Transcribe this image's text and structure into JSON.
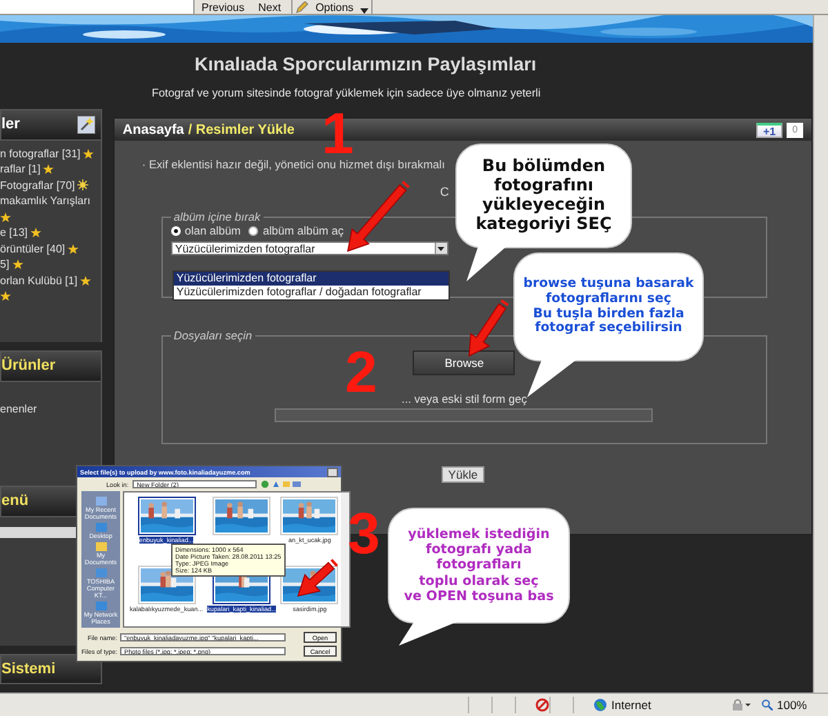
{
  "browser_toolbar": {
    "buttons": [
      "Previous",
      "Next"
    ],
    "options": "Options"
  },
  "header": {
    "title": "Kınalıada Sporcularımızın Paylaşımları",
    "subtitle": "Fotograf ve yorum sitesinde fotograf yüklemek için sadece üye olmanız yeterli"
  },
  "sidebar": {
    "panels": [
      {
        "title": "ler",
        "color": "#ffffff",
        "kind": "list",
        "items": [
          {
            "label": "n fotograflar [31]",
            "kind": "new"
          },
          {
            "label": "raflar [1]",
            "kind": "new"
          },
          {
            "label": "Fotograflar [70]",
            "kind": "hot"
          },
          {
            "label": "makamlık Yarışları",
            "kind": "plain"
          },
          {
            "kind": "new"
          },
          {
            "label": "e [13]",
            "kind": "new"
          },
          {
            "label": "örüntüler [40]",
            "kind": "new"
          },
          {
            "label": "5]",
            "kind": "new"
          },
          {
            "label": "orlan Kulübü [1]",
            "kind": "new"
          },
          {
            "kind": "new"
          }
        ]
      },
      {
        "title": "Ürünler",
        "color": "#f0e060",
        "kind": "links",
        "items": [
          {
            "label": "enenler"
          }
        ]
      },
      {
        "title": "enü",
        "color": "#f0e060",
        "kind": "menu"
      },
      {
        "title": "Sistemi",
        "color": "#f0e060",
        "kind": "header"
      }
    ]
  },
  "main": {
    "home": "Anasayfa",
    "current": "/ Resimler Yükle",
    "plus_one": {
      "label": "+1",
      "count": "0"
    },
    "notice": "· Exif eklentisi hazır değil, yönetici onu hizmet dışı bırakmalı",
    "partial_text": "C",
    "album": {
      "legend": "albüm içine bırak",
      "radios": [
        {
          "label": "olan albüm",
          "selected": true
        },
        {
          "label": "albüm albüm aç",
          "selected": false
        }
      ],
      "select_value": "Yüzücülerimizden fotograflar",
      "options": [
        {
          "label": "Yüzücülerimizden fotograflar",
          "selected": true
        },
        {
          "label": "Yüzücülerimizden fotograflar / doğadan fotograflar",
          "selected": false
        }
      ]
    },
    "files": {
      "legend": "Dosyaları seçin",
      "browse": "Browse",
      "alt_link": "... veya eski stil form geç"
    },
    "upload": "Yükle"
  },
  "callouts": [
    {
      "number": "1",
      "text": "Bu bölümden\nfotografını\nyükleyeceğin\nkategoriyi SEÇ",
      "color": "#111111"
    },
    {
      "number": "2",
      "text": "browse tuşuna basarak\nfotograflarını seç\nBu tuşla birden fazla\nfotograf seçebilirsin",
      "color": "#1a4fd6"
    },
    {
      "number": "3",
      "text": "yüklemek istediğin\nfotografı  yada\nfotografları\ntoplu olarak seç\nve OPEN toşuna bas",
      "color": "#b02cc0"
    }
  ],
  "dialog": {
    "title": "Select file(s) to upload by www.foto.kinaliadayuzme.com",
    "look_in_label": "Look in:",
    "folder": "New Folder (2)",
    "places": [
      "My Recent Documents",
      "Desktop",
      "My Documents",
      "TOSHIBA Computer KT...",
      "My Network Places"
    ],
    "files": [
      {
        "name": "enbuyuk_kinaliad...",
        "selected": true
      },
      {
        "selected": false
      },
      {
        "name": "an_kt_ucak.jpg",
        "selected": false
      },
      {
        "name": "kalabalıkyuzmede_kuan...",
        "selected": false
      },
      {
        "name": "kupalari_kapti_kinaliad...",
        "selected": true
      },
      {
        "name": "sasirdim.jpg",
        "selected": false
      }
    ],
    "tooltip": [
      "Dimensions: 1000 x 564",
      "Date Picture Taken: 28.08.2011 13:25",
      "Type: JPEG Image",
      "Size: 124 KB"
    ],
    "file_name_label": "File name:",
    "file_name": "\"enbuyuk_kinaliadayuzme.jpg\" \"kupalari_kapti...",
    "type_label": "Files of type:",
    "type": "Photo files (*.jpg; *.jpeg; *.png)",
    "buttons": [
      "Open",
      "Cancel"
    ]
  },
  "status_bar": {
    "zone": "Internet",
    "zoom": "100%"
  }
}
